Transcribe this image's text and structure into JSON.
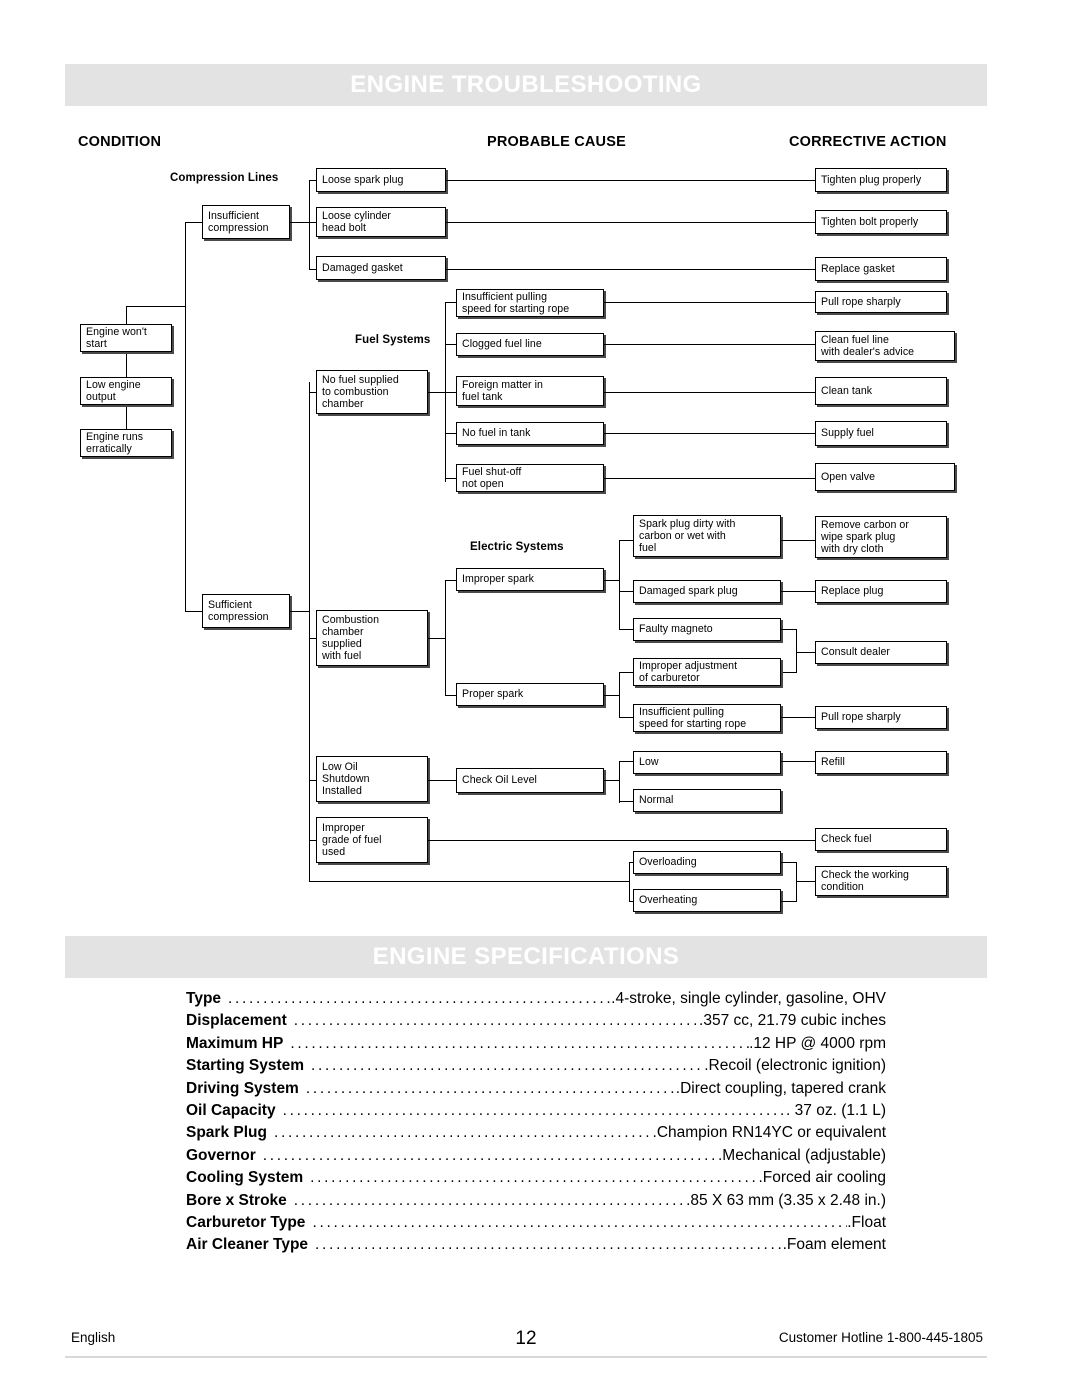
{
  "sections": {
    "troubleshooting_title": "ENGINE TROUBLESHOOTING",
    "specifications_title": "ENGINE SPECIFICATIONS"
  },
  "flowchart": {
    "column_headings": {
      "condition": "CONDITION",
      "probable_cause": "PROBABLE CAUSE",
      "corrective_action": "CORRECTIVE ACTION"
    },
    "group_labels": {
      "compression_lines": "Compression Lines",
      "fuel_systems": "Fuel Systems",
      "electric_systems": "Electric Systems"
    },
    "conditions": [
      {
        "id": "engine-wont-start",
        "label": "Engine won't\nstart"
      },
      {
        "id": "low-engine-output",
        "label": "Low engine\noutput"
      },
      {
        "id": "engine-runs-erratically",
        "label": "Engine runs\nerratically"
      }
    ],
    "compression_branch": [
      {
        "id": "insufficient-compression",
        "label": "Insufficient\ncompression"
      },
      {
        "id": "sufficient-compression",
        "label": "Sufficient\ncompression"
      }
    ],
    "causes": {
      "loose_spark_plug": "Loose spark plug",
      "loose_cylinder_head_bolt": "Loose cylinder\nhead bolt",
      "damaged_gasket": "Damaged gasket",
      "no_fuel_supplied": "No fuel supplied\nto combustion\nchamber",
      "insufficient_pulling_speed_1": "Insufficient pulling\nspeed for starting rope",
      "clogged_fuel_line": "Clogged fuel line",
      "foreign_matter_in_fuel_tank": "Foreign matter in\nfuel tank",
      "no_fuel_in_tank": "No fuel in tank",
      "fuel_shutoff_not_open": "Fuel shut-off\nnot open",
      "combustion_chamber_supplied": "Combustion\nchamber\nsupplied\nwith fuel",
      "improper_spark": "Improper spark",
      "proper_spark": "Proper spark",
      "spark_plug_dirty": "Spark plug dirty with\ncarbon or wet with\nfuel",
      "damaged_spark_plug": "Damaged spark plug",
      "faulty_magneto": "Faulty magneto",
      "improper_adjustment_carburetor": "Improper adjustment\nof carburetor",
      "insufficient_pulling_speed_2": "Insufficient pulling\nspeed for starting rope",
      "low_oil_shutdown": "Low Oil\nShutdown\nInstalled",
      "check_oil_level": "Check Oil Level",
      "oil_low": "Low",
      "oil_normal": "Normal",
      "improper_grade_of_fuel": "Improper\ngrade of fuel\nused",
      "overloading": "Overloading",
      "overheating": "Overheating"
    },
    "actions": {
      "tighten_plug_properly": "Tighten plug properly",
      "tighten_bolt_properly": "Tighten bolt properly",
      "replace_gasket": "Replace gasket",
      "pull_rope_sharply_1": "Pull rope sharply",
      "clean_fuel_line": "Clean fuel line\nwith dealer's advice",
      "clean_tank": "Clean tank",
      "supply_fuel": "Supply fuel",
      "open_valve": "Open valve",
      "remove_carbon": "Remove carbon or\nwipe spark plug\nwith dry cloth",
      "replace_plug": "Replace plug",
      "consult_dealer": "Consult dealer",
      "pull_rope_sharply_2": "Pull rope sharply",
      "refill": "Refill",
      "check_fuel": "Check fuel",
      "check_working_condition": "Check the working\ncondition"
    }
  },
  "specifications": [
    {
      "label": "Type",
      "value": ".4-stroke, single cylinder, gasoline, OHV"
    },
    {
      "label": "Displacement",
      "value": ".357 cc, 21.79 cubic inches"
    },
    {
      "label": "Maximum HP",
      "value": ".12 HP @ 4000 rpm"
    },
    {
      "label": "Starting System",
      "value": ".Recoil (electronic ignition)"
    },
    {
      "label": "Driving System",
      "value": ".Direct coupling, tapered crank"
    },
    {
      "label": "Oil Capacity",
      "value": ". 37 oz. (1.1 L)"
    },
    {
      "label": "Spark Plug",
      "value": ".Champion RN14YC or equivalent"
    },
    {
      "label": "Governor",
      "value": ".Mechanical (adjustable)"
    },
    {
      "label": "Cooling System",
      "value": ".Forced air cooling"
    },
    {
      "label": "Bore x Stroke",
      "value": ".85 X 63 mm (3.35 x 2.48 in.)"
    },
    {
      "label": "Carburetor Type",
      "value": ".Float"
    },
    {
      "label": "Air Cleaner Type",
      "value": ".Foam element"
    }
  ],
  "footer": {
    "language": "English",
    "page_number": "12",
    "hotline": "Customer Hotline 1-800-445-1805"
  }
}
